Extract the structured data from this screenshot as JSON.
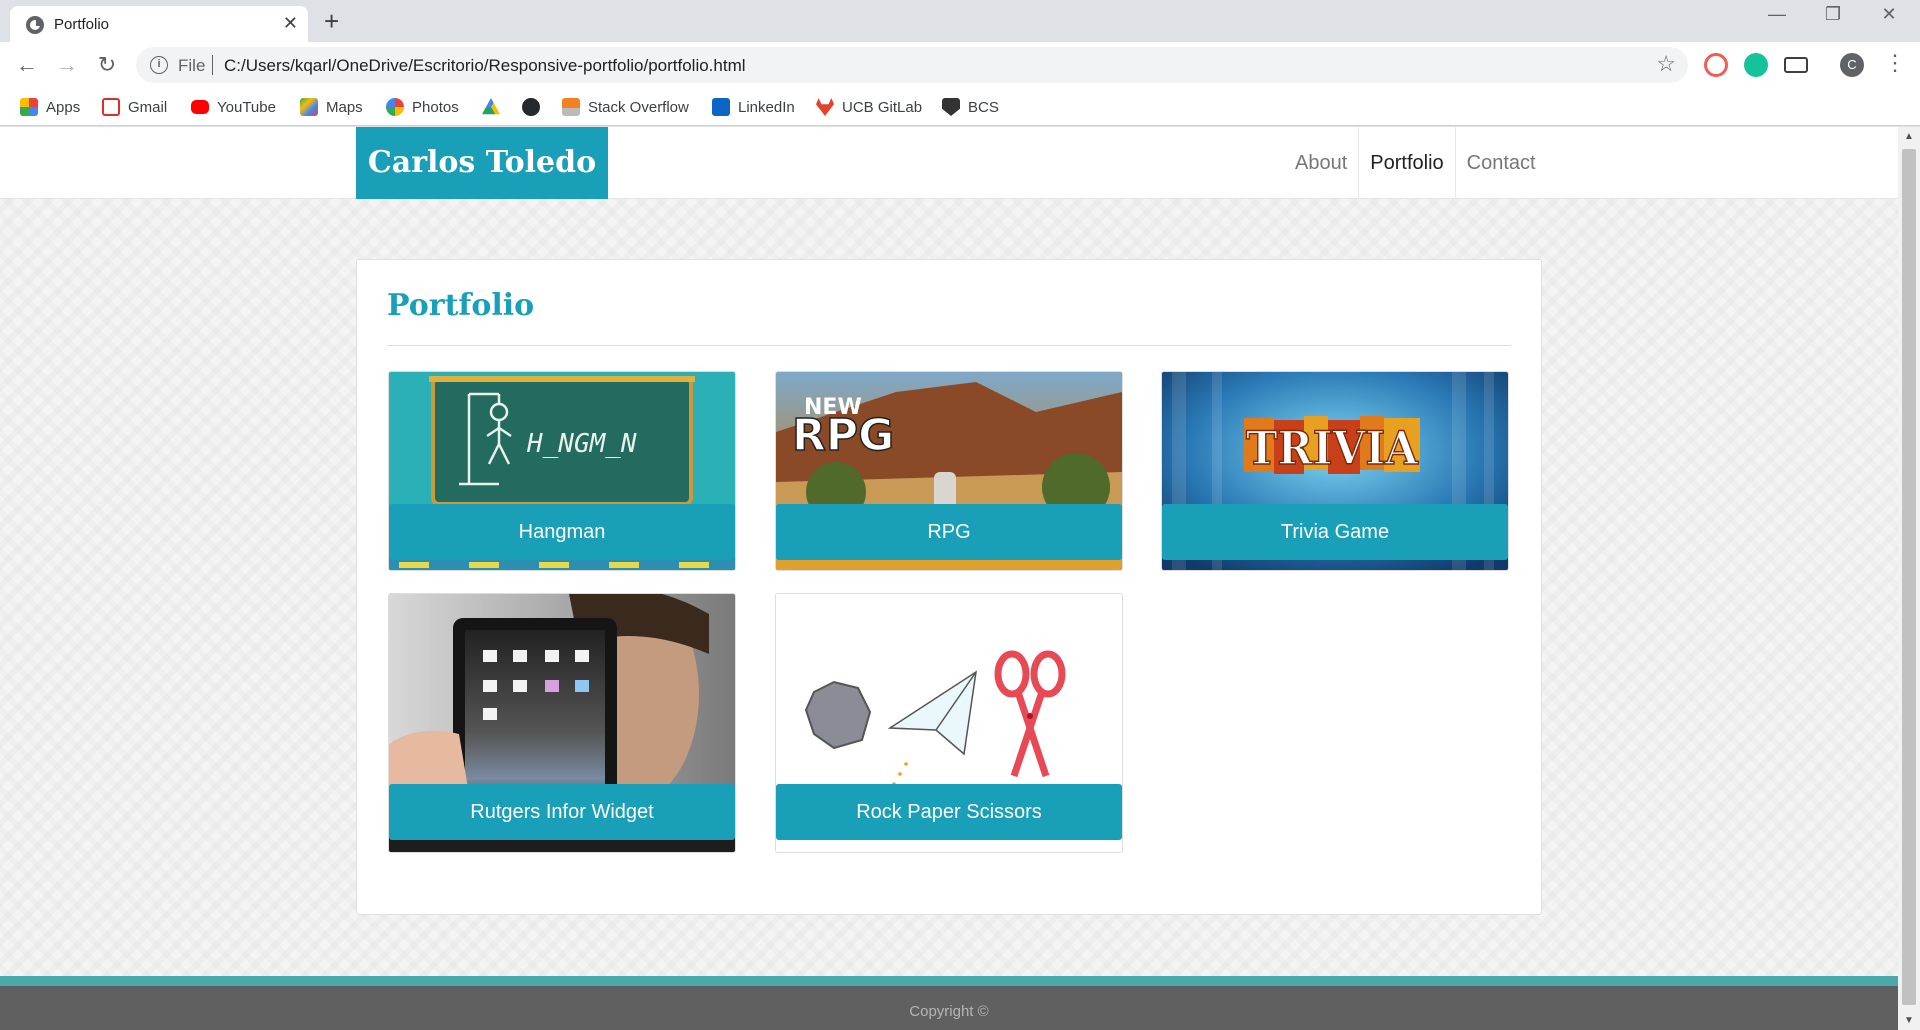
{
  "browser": {
    "tab_title": "Portfolio",
    "tab_close": "✕",
    "new_tab": "+",
    "minimize": "—",
    "restore": "❐",
    "close": "✕",
    "back": "←",
    "forward": "→",
    "reload": "↻",
    "info": "i",
    "scheme": "File",
    "url": "C:/Users/kqarl/OneDrive/Escritorio/Responsive-portfolio/portfolio.html",
    "star": "☆",
    "avatar": "C",
    "menu": "⋮"
  },
  "bookmarks": [
    {
      "label": "Apps",
      "icon": "apps-grid-icon",
      "color": "#ea4335"
    },
    {
      "label": "Gmail",
      "icon": "gmail-icon",
      "color": "#d93025"
    },
    {
      "label": "YouTube",
      "icon": "youtube-icon",
      "color": "#ff0000"
    },
    {
      "label": "Maps",
      "icon": "maps-icon",
      "color": "#34a853"
    },
    {
      "label": "Photos",
      "icon": "photos-icon",
      "color": "#fbbc04"
    },
    {
      "label": "",
      "icon": "google-drive-icon",
      "color": "#1fa463"
    },
    {
      "label": "",
      "icon": "github-icon",
      "color": "#24292e"
    },
    {
      "label": "Stack Overflow",
      "icon": "stackoverflow-icon",
      "color": "#f48024"
    },
    {
      "label": "LinkedIn",
      "icon": "linkedin-icon",
      "color": "#0a66c2"
    },
    {
      "label": "UCB GitLab",
      "icon": "gitlab-icon",
      "color": "#e24329"
    },
    {
      "label": "BCS",
      "icon": "bcs-shield-icon",
      "color": "#333333"
    }
  ],
  "site": {
    "brand": "Carlos Toledo",
    "nav": {
      "about": "About",
      "portfolio": "Portfolio",
      "contact": "Contact"
    },
    "heading": "Portfolio",
    "projects": [
      {
        "title": "Hangman",
        "image_text": "H_NGM_N"
      },
      {
        "title": "RPG",
        "image_text": "NEW RPG"
      },
      {
        "title": "Trivia Game",
        "image_text": "TRIVIA"
      },
      {
        "title": "Rutgers Infor Widget",
        "image_text": ""
      },
      {
        "title": "Rock Paper Scissors",
        "image_text": ""
      }
    ],
    "footer": "Copyright ©"
  },
  "colors": {
    "accent": "#1a9fb8",
    "footer": "#606060",
    "footer_stripe": "#4aa9ab"
  }
}
